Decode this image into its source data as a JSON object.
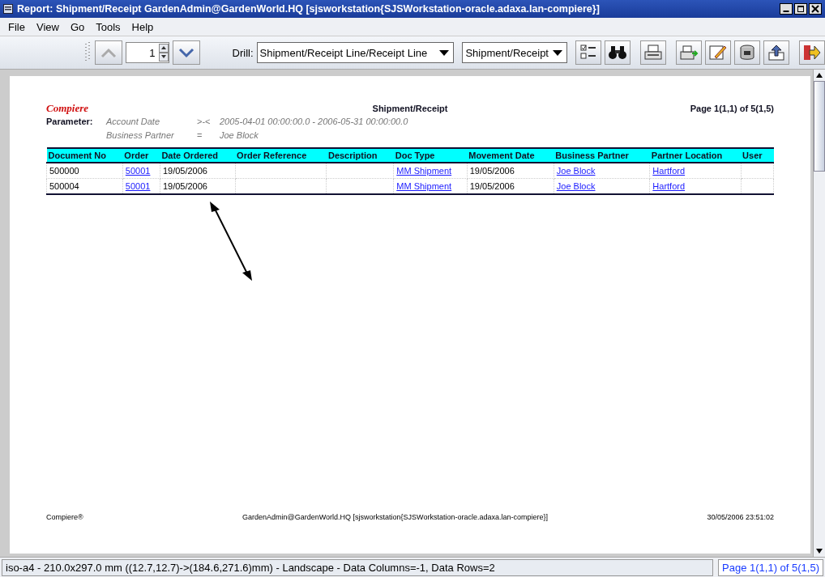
{
  "window": {
    "title": "Report: Shipment/Receipt  GardenAdmin@GardenWorld.HQ [sjsworkstation{SJSWorkstation-oracle.adaxa.lan-compiere}]"
  },
  "menu": [
    "File",
    "View",
    "Go",
    "Tools",
    "Help"
  ],
  "toolbar": {
    "page_spinner": "1",
    "drill_label": "Drill:",
    "drill_value": "Shipment/Receipt Line/Receipt Line",
    "report_value": "Shipment/Receipt"
  },
  "report": {
    "logo": "Compiere",
    "title": "Shipment/Receipt",
    "page": "Page 1(1,1) of 5(1,5)",
    "parameter_label": "Parameter:",
    "parameters": [
      {
        "name": "Account Date",
        "operator": ">-<",
        "value": "2005-04-01 00:00:00.0 - 2006-05-31 00:00:00.0"
      },
      {
        "name": "Business Partner",
        "operator": "=",
        "value": "Joe Block"
      }
    ],
    "columns": [
      "Document No",
      "Order",
      "Date Ordered",
      "Order Reference",
      "Description",
      "Doc Type",
      "Movement Date",
      "Business Partner",
      "Partner Location",
      "User"
    ],
    "rows": [
      [
        {
          "text": "500000",
          "link": false
        },
        {
          "text": "50001",
          "link": true
        },
        {
          "text": "19/05/2006",
          "link": false
        },
        null,
        null,
        {
          "text": "MM Shipment",
          "link": true
        },
        {
          "text": "19/05/2006",
          "link": false
        },
        {
          "text": "Joe Block",
          "link": true
        },
        {
          "text": "Hartford",
          "link": true
        },
        null
      ],
      [
        {
          "text": "500004",
          "link": false
        },
        {
          "text": "50001",
          "link": true
        },
        {
          "text": "19/05/2006",
          "link": false
        },
        null,
        null,
        {
          "text": "MM Shipment",
          "link": true
        },
        {
          "text": "19/05/2006",
          "link": false
        },
        {
          "text": "Joe Block",
          "link": true
        },
        {
          "text": "Hartford",
          "link": true
        },
        null
      ]
    ],
    "footer_left": "Compiere®",
    "footer_center": "GardenAdmin@GardenWorld.HQ [sjsworkstation{SJSWorkstation-oracle.adaxa.lan-compiere}]",
    "footer_right": "30/05/2006 23:51:02"
  },
  "status_bar": {
    "info": "iso-a4 - 210.0x297.0 mm ((12.7,12.7)->(184.6,271.6)mm) - Landscape - Data Columns=-1, Data Rows=2",
    "page": "Page 1(1,1) of 5(1,5)"
  }
}
